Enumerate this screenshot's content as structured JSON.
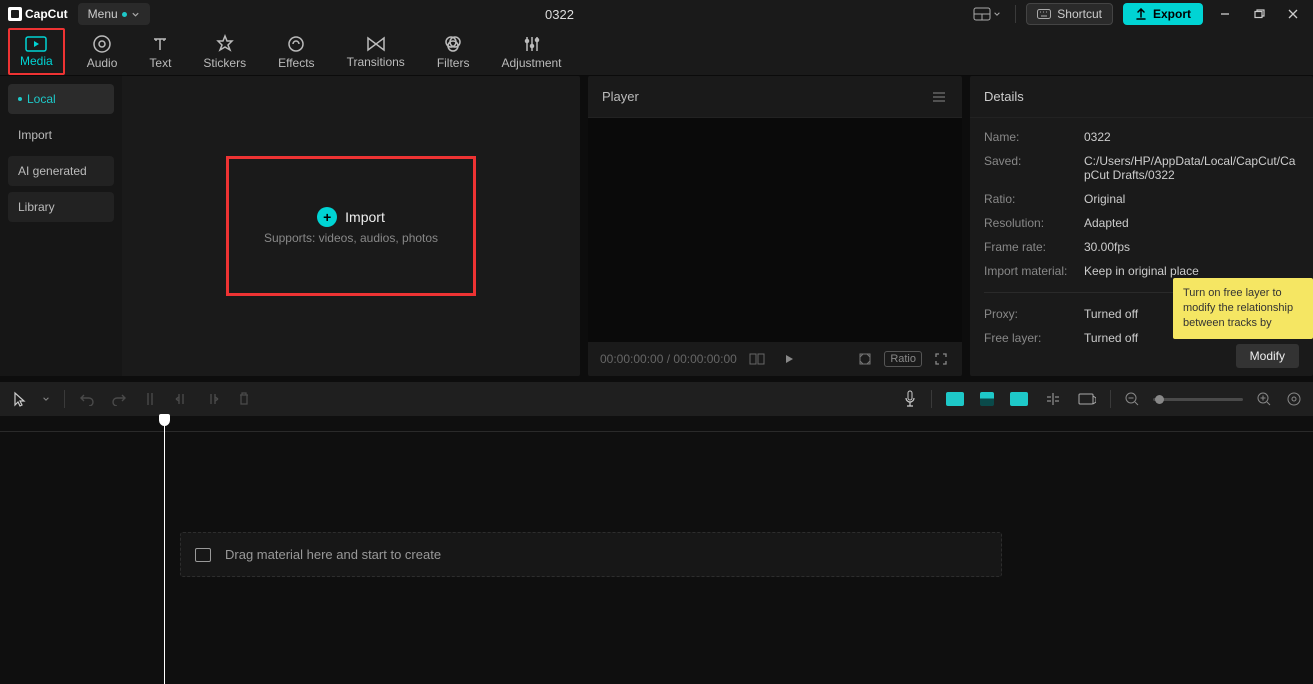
{
  "titlebar": {
    "logo_text": "CapCut",
    "menu_label": "Menu",
    "project_title": "0322",
    "shortcut_label": "Shortcut",
    "export_label": "Export"
  },
  "tabs": {
    "media": "Media",
    "audio": "Audio",
    "text": "Text",
    "stickers": "Stickers",
    "effects": "Effects",
    "transitions": "Transitions",
    "filters": "Filters",
    "adjustment": "Adjustment"
  },
  "sidebar": {
    "local": "Local",
    "import": "Import",
    "ai": "AI generated",
    "library": "Library"
  },
  "import_box": {
    "title": "Import",
    "subtitle": "Supports: videos, audios, photos"
  },
  "player": {
    "title": "Player",
    "time": "00:00:00:00 / 00:00:00:00",
    "ratio_label": "Ratio"
  },
  "details": {
    "title": "Details",
    "name_label": "Name:",
    "name_value": "0322",
    "saved_label": "Saved:",
    "saved_value": "C:/Users/HP/AppData/Local/CapCut/CapCut Drafts/0322",
    "ratio_label": "Ratio:",
    "ratio_value": "Original",
    "resolution_label": "Resolution:",
    "resolution_value": "Adapted",
    "framerate_label": "Frame rate:",
    "framerate_value": "30.00fps",
    "importmat_label": "Import material:",
    "importmat_value": "Keep in original place",
    "proxy_label": "Proxy:",
    "proxy_value": "Turned off",
    "freelayer_label": "Free layer:",
    "freelayer_value": "Turned off",
    "tooltip_text": "Turn on free layer to modify the relationship between tracks by",
    "modify_label": "Modify"
  },
  "timeline": {
    "hint": "Drag material here and start to create"
  }
}
